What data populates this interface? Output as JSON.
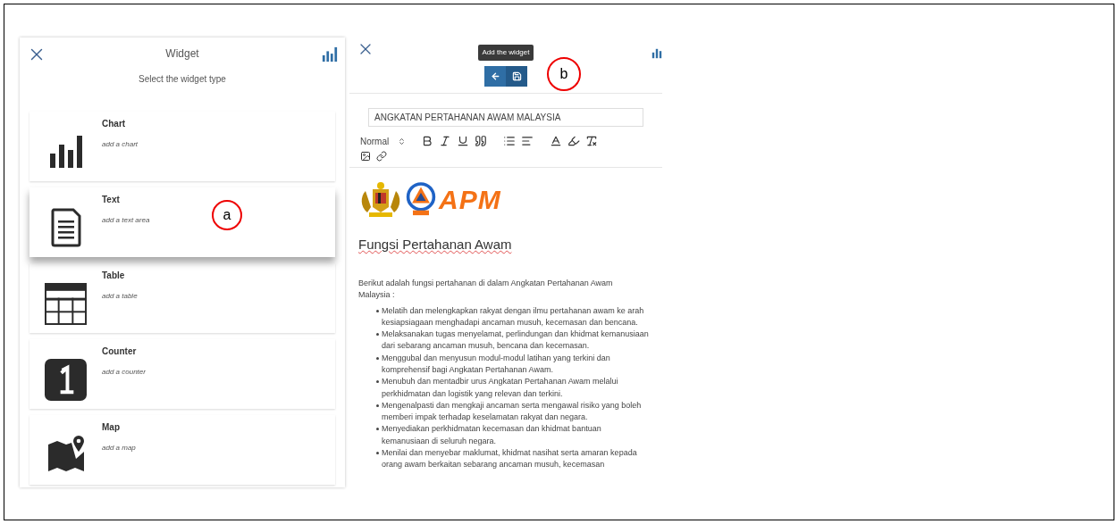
{
  "left_panel": {
    "title": "Widget",
    "subtitle": "Select the widget type",
    "widget_types": [
      {
        "kind": "chart",
        "title": "Chart",
        "description": "add a chart",
        "hovered": false
      },
      {
        "kind": "text",
        "title": "Text",
        "description": "add a text area",
        "hovered": true
      },
      {
        "kind": "table",
        "title": "Table",
        "description": "add a table",
        "hovered": false
      },
      {
        "kind": "counter",
        "title": "Counter",
        "description": "add a counter",
        "hovered": false
      },
      {
        "kind": "map",
        "title": "Map",
        "description": "add a map",
        "hovered": false
      }
    ]
  },
  "right_panel": {
    "tooltip": "Add the widget",
    "title_field": {
      "value": "ANGKATAN PERTAHANAN AWAM MALAYSIA"
    },
    "style_select": "Normal",
    "logo_text": "APM",
    "heading": "Fungsi Pertahanan Awam",
    "intro": "Berikut adalah fungsi pertahanan di dalam Angkatan Pertahanan Awam Malaysia :",
    "bullets": [
      "Melatih dan melengkapkan rakyat dengan ilmu pertahanan awam ke arah kesiapsiagaan menghadapi ancaman musuh, kecemasan dan bencana.",
      "Melaksanakan tugas menyelamat, perlindungan dan khidmat kemanusiaan dari sebarang ancaman musuh, bencana dan kecemasan.",
      "Menggubal dan menyusun modul-modul latihan yang terkini dan komprehensif bagi Angkatan Pertahanan Awam.",
      "Menubuh dan mentadbir urus Angkatan Pertahanan Awam melalui perkhidmatan dan logistik yang relevan dan terkini.",
      "Mengenalpasti dan mengkaji ancaman serta mengawal risiko yang boleh memberi impak terhadap keselamatan rakyat dan negara.",
      "Menyediakan perkhidmatan kecemasan dan khidmat bantuan kemanusiaan di seluruh negara.",
      "Menilai dan menyebar maklumat, khidmat nasihat serta amaran kepada orang awam berkaitan sebarang ancaman musuh, kecemasan"
    ]
  },
  "annotations": [
    "a",
    "b"
  ]
}
